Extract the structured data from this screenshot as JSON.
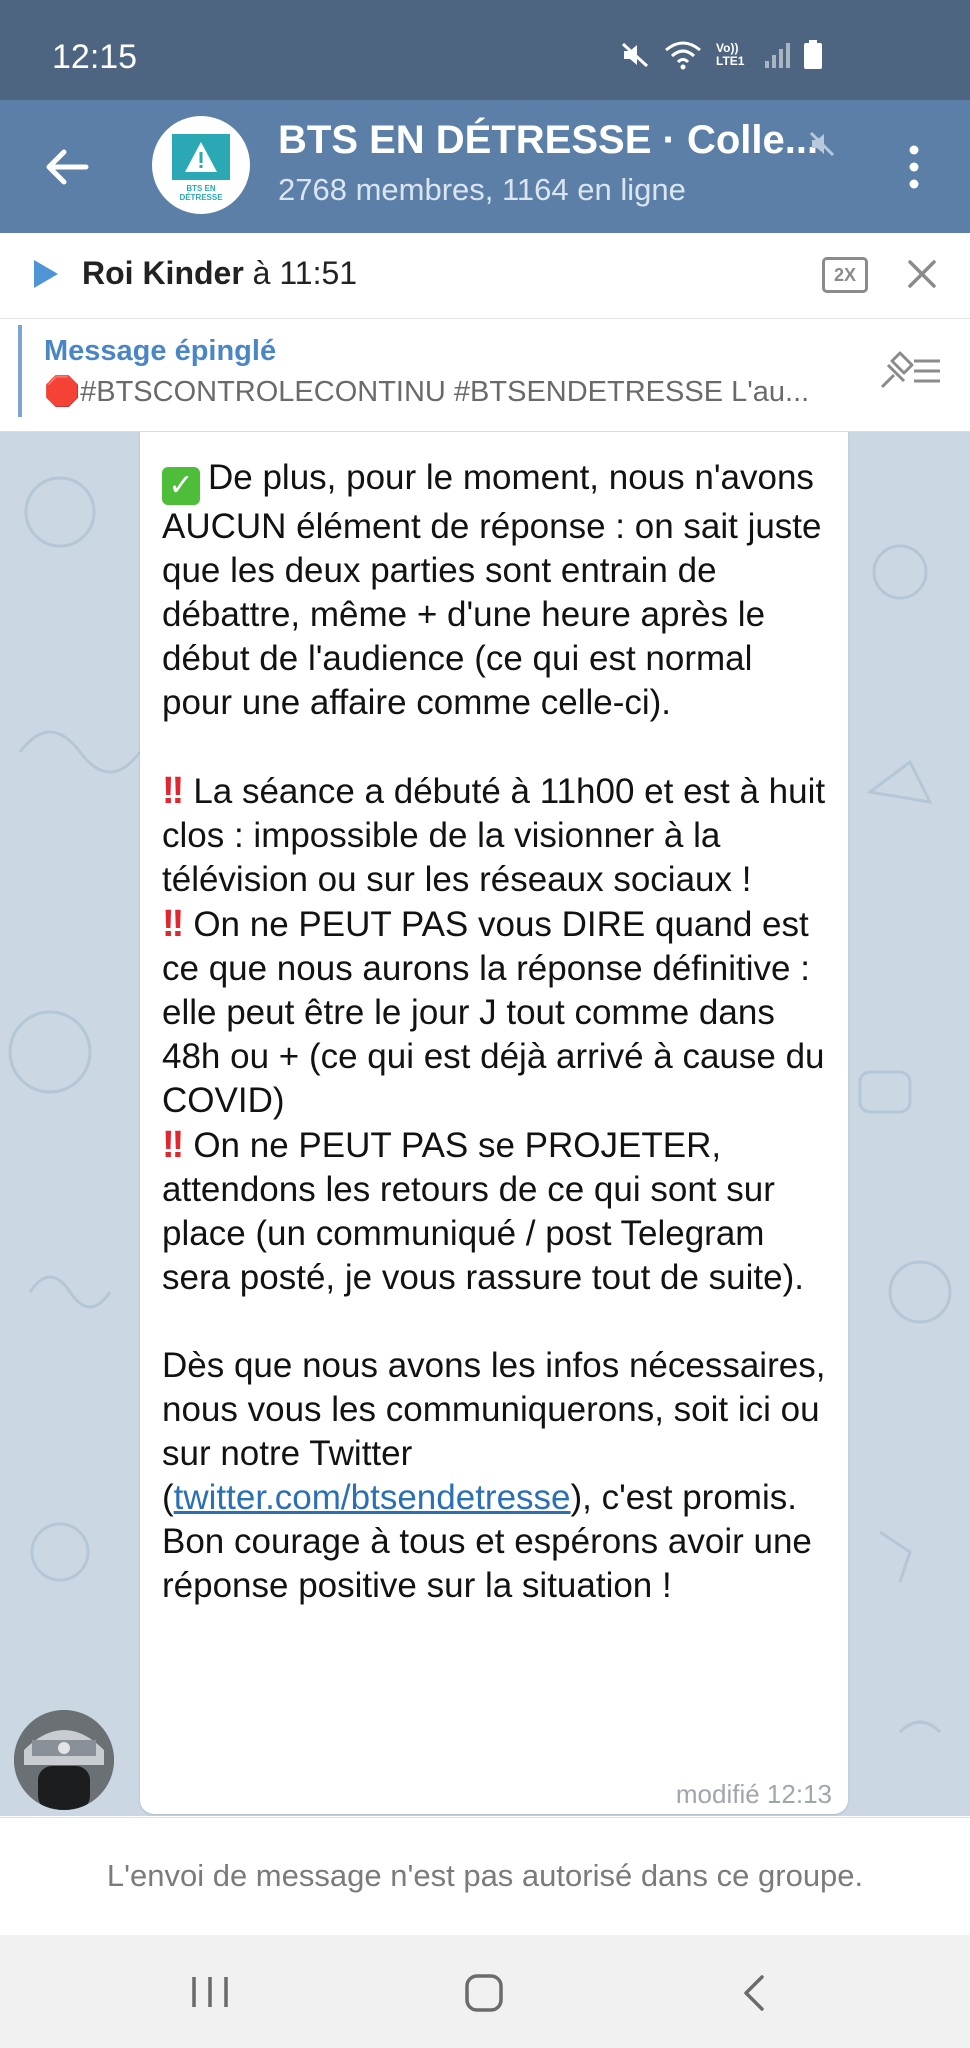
{
  "status_bar": {
    "time": "12:15",
    "network_label": "Vo)) LTE1"
  },
  "header": {
    "title": "BTS EN DÉTRESSE · Colle...",
    "subtitle": "2768 membres, 1164 en ligne",
    "avatar_text": "BTS EN DÉTRESSE"
  },
  "audio_player": {
    "sender": "Roi Kinder",
    "time_text": " à 11:51",
    "speed_label": "2X"
  },
  "pinned": {
    "label": "Message épinglé",
    "text": "🛑#BTSCONTROLECONTINU #BTSENDETRESSE   L'au..."
  },
  "message": {
    "p1": "De plus, pour le moment, nous n'avons AUCUN élément de réponse : on sait juste que les deux parties sont entrain de débattre, même + d'une heure après le début de l'audience (ce qui est normal pour une affaire comme celle-ci).",
    "p2": "La séance a débuté à 11h00 et est à huit clos : impossible de la visionner à la télévision ou sur les réseaux sociaux !",
    "p3": "On ne PEUT PAS vous DIRE quand est ce que nous aurons la réponse définitive : elle peut être le jour J tout comme dans 48h ou + (ce qui est déjà arrivé à cause du COVID)",
    "p4": "On ne PEUT PAS se PROJETER, attendons les retours de ce qui sont sur place (un communiqué / post Telegram sera posté, je vous rassure tout de suite).",
    "p5_before": "Dès que nous avons les infos nécessaires, nous vous les communiquerons, soit ici ou sur notre Twitter (",
    "p5_link": "twitter.com/btsendetresse",
    "p5_after": "), c'est promis.",
    "p6": "Bon courage à tous et espérons avoir une réponse positive sur la situation !",
    "time": "modifié 12:13"
  },
  "footer": {
    "text": "L'envoi de message n'est pas autorisé dans ce groupe."
  },
  "colors": {
    "header": "#5b7fa7",
    "status_bar": "#4e6581",
    "chat_bg": "#cbd8e4",
    "link": "#2b6fb4"
  },
  "icons": [
    "mute-icon",
    "wifi-icon",
    "signal-icon",
    "battery-icon",
    "back-arrow-icon",
    "muted-speaker-icon",
    "more-vert-icon",
    "play-icon",
    "close-icon",
    "unpin-icon",
    "recents-icon",
    "home-icon",
    "back-nav-icon"
  ]
}
